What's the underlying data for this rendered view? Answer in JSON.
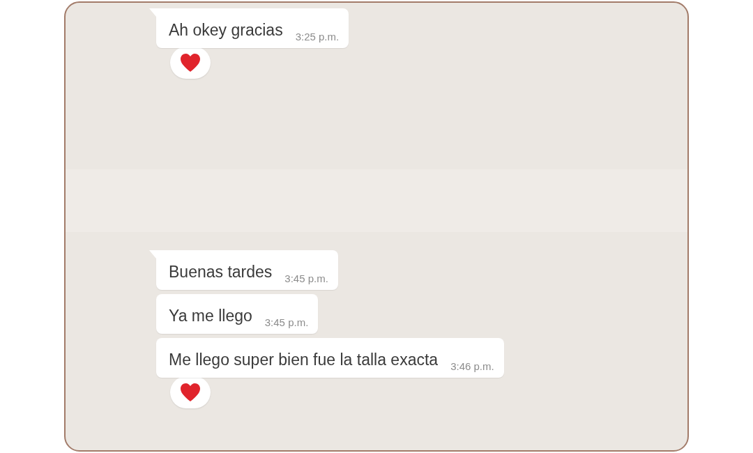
{
  "groups": [
    {
      "messages": [
        {
          "text": "Ah okey gracias",
          "time": "3:25 p.m.",
          "tail": true,
          "reacted": true
        }
      ]
    },
    {
      "messages": [
        {
          "text": "Buenas tardes",
          "time": "3:45 p.m.",
          "tail": true,
          "reacted": false
        },
        {
          "text": "Ya me llego",
          "time": "3:45 p.m.",
          "tail": false,
          "reacted": false
        },
        {
          "text": "Me llego super bien fue la talla exacta",
          "time": "3:46 p.m.",
          "tail": false,
          "reacted": true
        }
      ]
    }
  ]
}
